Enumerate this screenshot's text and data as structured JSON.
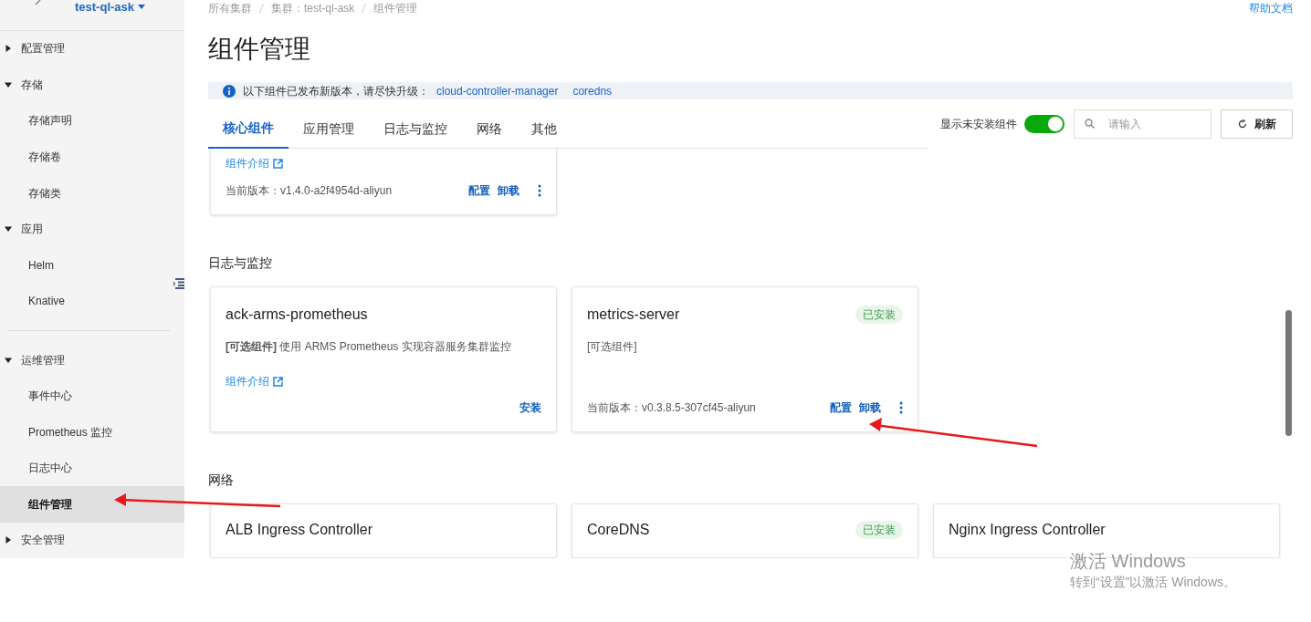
{
  "sidebar": {
    "cluster": "test-ql-ask",
    "items": [
      {
        "kind": "group",
        "label": "配置管理",
        "expanded": false
      },
      {
        "kind": "group",
        "label": "存储",
        "expanded": true,
        "children": [
          {
            "label": "存储声明",
            "selected": false
          },
          {
            "label": "存储卷",
            "selected": false
          },
          {
            "label": "存储类",
            "selected": false
          }
        ]
      },
      {
        "kind": "group",
        "label": "应用",
        "expanded": true,
        "children": [
          {
            "label": "Helm",
            "selected": false
          },
          {
            "label": "Knative",
            "selected": false
          }
        ]
      },
      {
        "kind": "divider"
      },
      {
        "kind": "group",
        "label": "运维管理",
        "expanded": true,
        "children": [
          {
            "label": "事件中心",
            "selected": false
          },
          {
            "label": "Prometheus 监控",
            "selected": false
          },
          {
            "label": "日志中心",
            "selected": false
          },
          {
            "label": "组件管理",
            "selected": true
          }
        ]
      },
      {
        "kind": "group",
        "label": "安全管理",
        "expanded": false
      }
    ]
  },
  "breadcrumb": [
    "所有集群",
    "集群：test-ql-ask",
    "组件管理"
  ],
  "help_link": "帮助文档",
  "title": "组件管理",
  "notice": {
    "text": "以下组件已发布新版本，请尽快升级：",
    "links": [
      "cloud-controller-manager",
      "coredns"
    ]
  },
  "tabs": [
    {
      "label": "核心组件",
      "selected": true
    },
    {
      "label": "应用管理",
      "selected": false
    },
    {
      "label": "日志与监控",
      "selected": false
    },
    {
      "label": "网络",
      "selected": false
    },
    {
      "label": "其他",
      "selected": false
    }
  ],
  "toggle": {
    "label": "显示未安装组件",
    "on": true
  },
  "search": {
    "placeholder": "请输入"
  },
  "refresh_button": "刷新",
  "sections": [
    {
      "cards": [
        {
          "intro_link": "组件介绍",
          "version": "当前版本：v1.4.0-a2f4954d-aliyun",
          "actions": [
            "配置",
            "卸载"
          ],
          "more": true
        }
      ]
    },
    {
      "title": "日志与监控",
      "cards": [
        {
          "name": "ack-arms-prometheus",
          "description": "**[可选组件]** 使用 ARMS Prometheus 实现容器服务集群监控",
          "intro_link": "组件介绍",
          "actions": [
            "安装"
          ],
          "more": false
        },
        {
          "name": "metrics-server",
          "badge": "已安装",
          "description": "[可选组件]",
          "version": "当前版本：v0.3.8.5-307cf45-aliyun",
          "actions": [
            "配置",
            "卸载"
          ],
          "more": true
        }
      ]
    },
    {
      "title": "网络",
      "cards": [
        {
          "name": "ALB Ingress Controller"
        },
        {
          "name": "CoreDNS",
          "badge": "已安装"
        },
        {
          "name": "Nginx Ingress Controller"
        }
      ]
    }
  ],
  "activation_notice": {
    "title": "激活 Windows",
    "subtitle": "转到“设置”以激活 Windows。"
  }
}
